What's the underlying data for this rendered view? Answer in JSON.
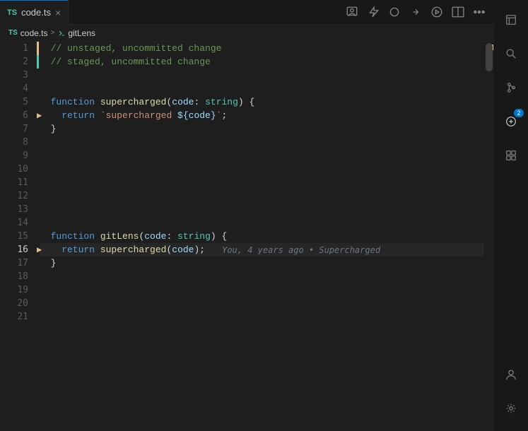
{
  "tab": {
    "lang": "TS",
    "filename": "code.ts",
    "close_icon": "×"
  },
  "breadcrumb": {
    "lang": "TS",
    "file": "code.ts",
    "sep": ">",
    "symbol": "gitLens"
  },
  "toolbar": {
    "icons": [
      "portrait",
      "lightning",
      "circle",
      "arrow-right",
      "play",
      "columns",
      "more"
    ]
  },
  "lines": [
    {
      "num": 1,
      "content": "comment",
      "text": "  // unstaged, uncommitted change",
      "indent": ""
    },
    {
      "num": 2,
      "content": "comment",
      "text": "  // staged, uncommitted change",
      "indent": ""
    },
    {
      "num": 3,
      "content": "empty",
      "text": "",
      "indent": ""
    },
    {
      "num": 4,
      "content": "empty",
      "text": "",
      "indent": ""
    },
    {
      "num": 5,
      "content": "function-def",
      "text": "  function supercharged(code: string) {",
      "indent": ""
    },
    {
      "num": 6,
      "content": "return",
      "text": "    return `supercharged ${code}`;",
      "indent": ""
    },
    {
      "num": 7,
      "content": "close",
      "text": "  }",
      "indent": ""
    },
    {
      "num": 8,
      "content": "empty",
      "text": "",
      "indent": ""
    },
    {
      "num": 9,
      "content": "empty",
      "text": "",
      "indent": ""
    },
    {
      "num": 10,
      "content": "empty",
      "text": "",
      "indent": ""
    },
    {
      "num": 11,
      "content": "empty",
      "text": "",
      "indent": ""
    },
    {
      "num": 12,
      "content": "empty",
      "text": "",
      "indent": ""
    },
    {
      "num": 13,
      "content": "empty",
      "text": "",
      "indent": ""
    },
    {
      "num": 14,
      "content": "empty",
      "text": "",
      "indent": ""
    },
    {
      "num": 15,
      "content": "function-def2",
      "text": "  function gitLens(code: string) {",
      "indent": ""
    },
    {
      "num": 16,
      "content": "active-return",
      "text": "    return supercharged(code);",
      "indent": "",
      "blame": "You, 4 years ago • Supercharged"
    },
    {
      "num": 17,
      "content": "close",
      "text": "  }",
      "indent": ""
    },
    {
      "num": 18,
      "content": "empty",
      "text": "",
      "indent": ""
    },
    {
      "num": 19,
      "content": "empty",
      "text": "",
      "indent": ""
    },
    {
      "num": 20,
      "content": "empty",
      "text": "",
      "indent": ""
    },
    {
      "num": 21,
      "content": "empty",
      "text": "",
      "indent": ""
    }
  ],
  "activity": {
    "icons": [
      "explorer",
      "search",
      "source-control",
      "gitlens",
      "extensions"
    ],
    "badge": "2",
    "bottom_icons": [
      "account",
      "settings"
    ]
  },
  "colors": {
    "keyword": "#569cd6",
    "function": "#dcdcaa",
    "variable": "#9cdcfe",
    "type": "#4ec9b0",
    "string": "#ce9178",
    "comment": "#6a9955",
    "unstaged": "#e2c08d",
    "staged": "#4ec9b0",
    "blame": "#6e7681"
  }
}
